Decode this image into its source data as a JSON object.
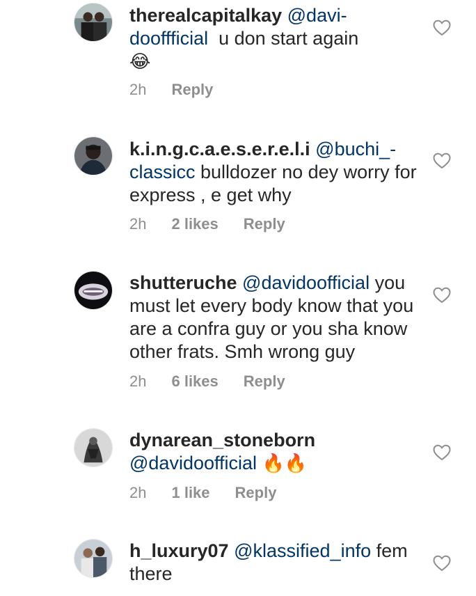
{
  "comments": [
    {
      "username": "therealcapitalkay",
      "mention": "@davi-dooffficial",
      "mention_part1": "@davi-",
      "mention_part2": "dooffficial",
      "text": "  u don start again",
      "emoji": "😂",
      "time": "2h",
      "likes": "",
      "reply": "Reply"
    },
    {
      "username": "k.i.n.g.c.a.e.s.e.r.e.l.i",
      "mention_part1": "@buchi_-",
      "mention_part2": "classicc",
      "text": " bulldozer no dey worry for express , e get why",
      "time": "2h",
      "likes": "2 likes",
      "reply": "Reply"
    },
    {
      "username": "shutteruche",
      "mention": "@davidoofficial",
      "text": " you must let every body know that you are a confra guy or you sha know other frats. Smh wrong guy",
      "time": "2h",
      "likes": "6 likes",
      "reply": "Reply"
    },
    {
      "username": "dynarean_stoneborn",
      "mention": "@davidoofficial",
      "emoji": "🔥🔥",
      "time": "2h",
      "likes": "1 like",
      "reply": "Reply"
    },
    {
      "username": "h_luxury07",
      "mention": "@klassified_info",
      "text": " fem there"
    }
  ],
  "colors": {
    "text": "#262626",
    "mention": "#003569",
    "meta": "#8e8e8e"
  },
  "icons": {
    "like": "heart-outline-icon"
  }
}
